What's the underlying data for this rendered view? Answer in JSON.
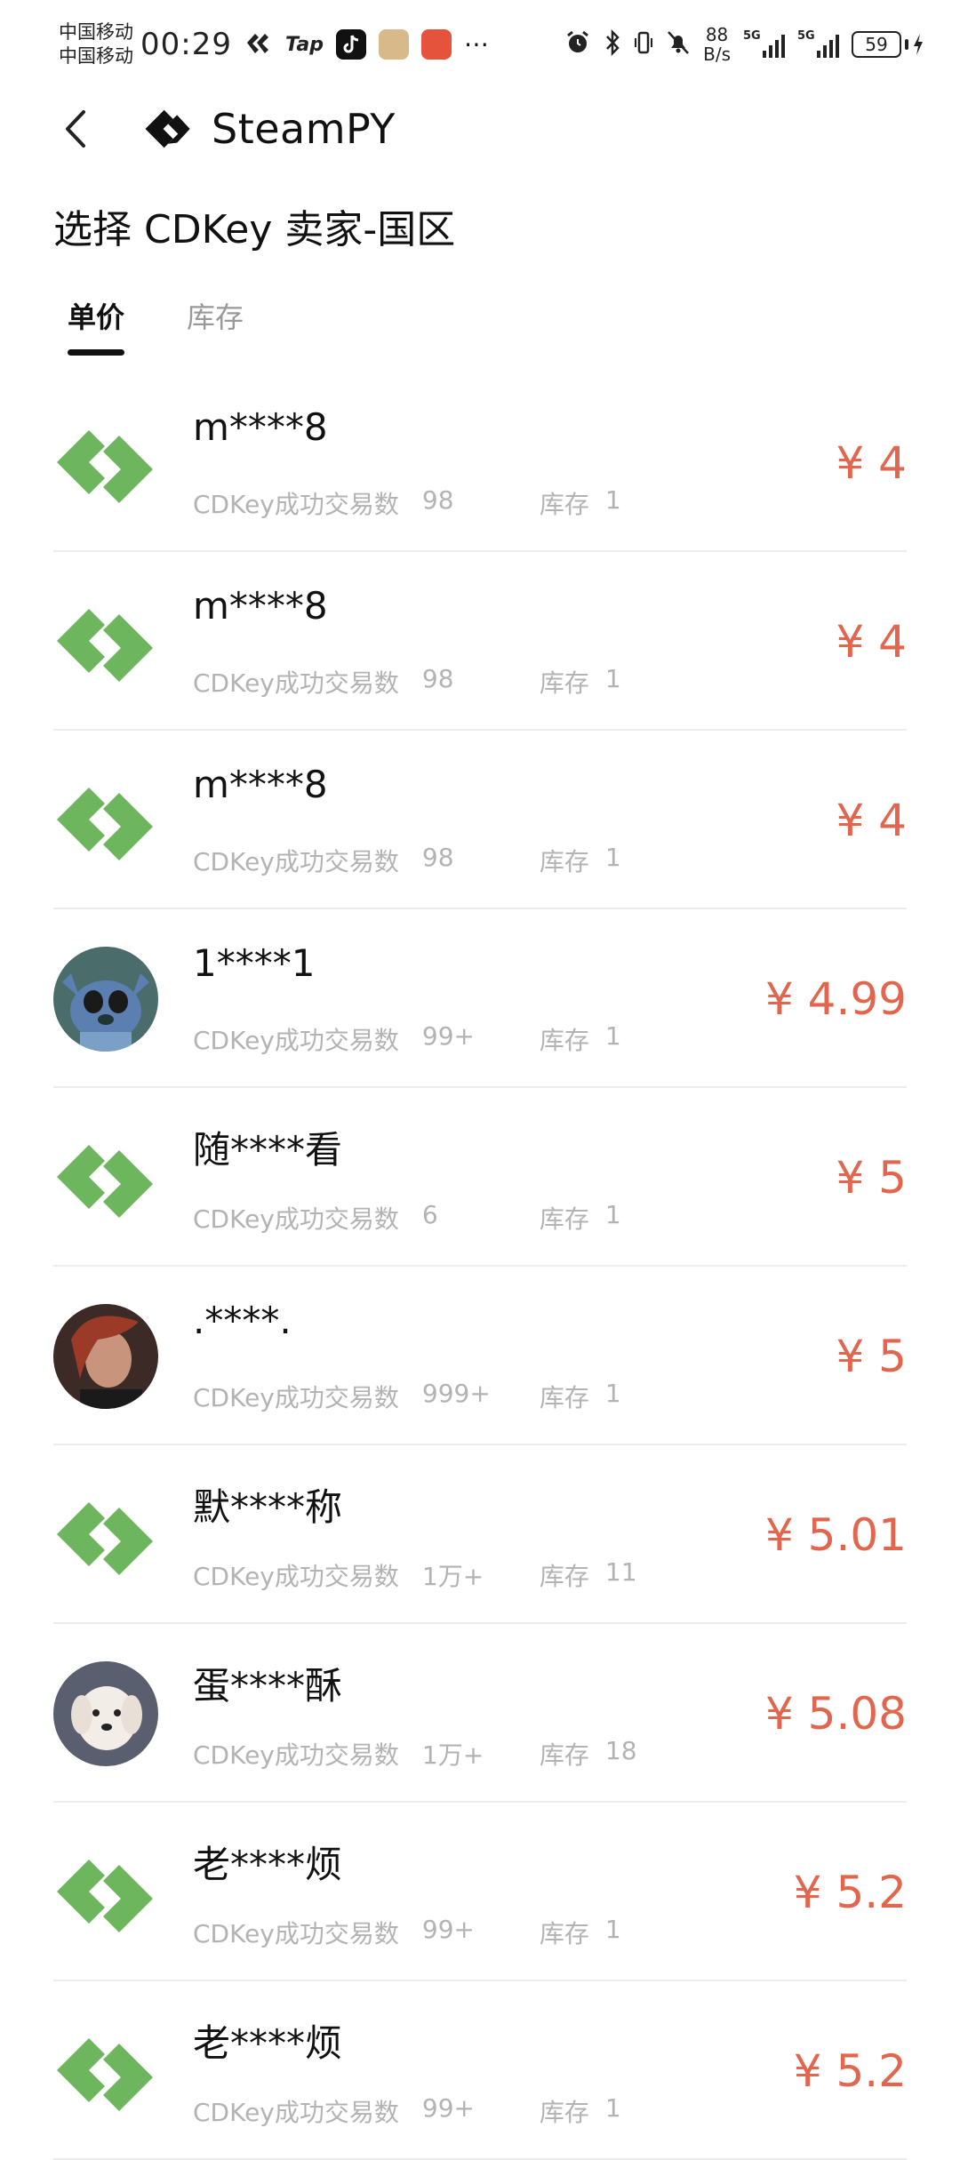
{
  "status_bar": {
    "carrier_1": "中国移动",
    "carrier_2": "中国移动",
    "time": "00:29",
    "app_tap": "Tap",
    "net_speed_value": "88",
    "net_speed_unit": "B/s",
    "signal_1_tag": "5G",
    "signal_2_tag": "5G",
    "battery": "59"
  },
  "nav": {
    "title": "SteamPY"
  },
  "page": {
    "title": "选择 CDKey 卖家-国区"
  },
  "tabs": [
    {
      "label": "单价",
      "active": true
    },
    {
      "label": "库存",
      "active": false
    }
  ],
  "colors": {
    "price": "#e2664e",
    "logo_green": "#6db65e",
    "meta_grey": "#b3b3b3"
  },
  "sellers": [
    {
      "name": "m****8",
      "avatar": "steampy-logo-icon",
      "trades_label": "CDKey成功交易数",
      "trades": "98",
      "stock_label": "库存",
      "stock": "1",
      "price": "¥ 4"
    },
    {
      "name": "m****8",
      "avatar": "steampy-logo-icon",
      "trades_label": "CDKey成功交易数",
      "trades": "98",
      "stock_label": "库存",
      "stock": "1",
      "price": "¥ 4"
    },
    {
      "name": "m****8",
      "avatar": "steampy-logo-icon",
      "trades_label": "CDKey成功交易数",
      "trades": "98",
      "stock_label": "库存",
      "stock": "1",
      "price": "¥ 4"
    },
    {
      "name": "1****1",
      "avatar": "cartoon-character-avatar",
      "trades_label": "CDKey成功交易数",
      "trades": "99+",
      "stock_label": "库存",
      "stock": "1",
      "price": "¥ 4.99"
    },
    {
      "name": "随****看",
      "avatar": "steampy-logo-icon",
      "trades_label": "CDKey成功交易数",
      "trades": "6",
      "stock_label": "库存",
      "stock": "1",
      "price": "¥ 5"
    },
    {
      "name": ".****.",
      "avatar": "portrait-avatar",
      "trades_label": "CDKey成功交易数",
      "trades": "999+",
      "stock_label": "库存",
      "stock": "1",
      "price": "¥ 5"
    },
    {
      "name": "默****称",
      "avatar": "steampy-logo-icon",
      "trades_label": "CDKey成功交易数",
      "trades": "1万+",
      "stock_label": "库存",
      "stock": "11",
      "price": "¥ 5.01"
    },
    {
      "name": "蛋****酥",
      "avatar": "dog-photo-avatar",
      "trades_label": "CDKey成功交易数",
      "trades": "1万+",
      "stock_label": "库存",
      "stock": "18",
      "price": "¥ 5.08"
    },
    {
      "name": "老****烦",
      "avatar": "steampy-logo-icon",
      "trades_label": "CDKey成功交易数",
      "trades": "99+",
      "stock_label": "库存",
      "stock": "1",
      "price": "¥ 5.2"
    },
    {
      "name": "老****烦",
      "avatar": "steampy-logo-icon",
      "trades_label": "CDKey成功交易数",
      "trades": "99+",
      "stock_label": "库存",
      "stock": "1",
      "price": "¥ 5.2"
    }
  ]
}
